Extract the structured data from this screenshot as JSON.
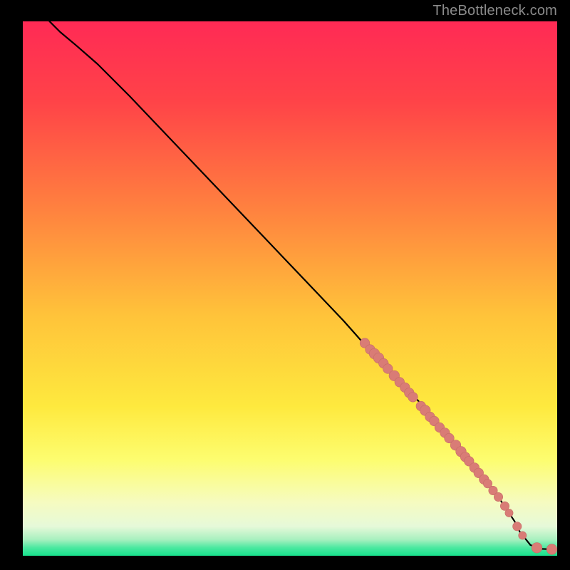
{
  "attribution": "TheBottleneck.com",
  "colors": {
    "frame_bg": "#000000",
    "attribution_text": "#8b8b8b",
    "curve": "#000000",
    "point_fill": "#d97c76",
    "point_stroke": "#c56c66",
    "gradient_stops": [
      {
        "offset": 0,
        "color": "#ff2a55"
      },
      {
        "offset": 0.15,
        "color": "#ff4348"
      },
      {
        "offset": 0.35,
        "color": "#ff813f"
      },
      {
        "offset": 0.55,
        "color": "#ffc33a"
      },
      {
        "offset": 0.72,
        "color": "#fee93e"
      },
      {
        "offset": 0.82,
        "color": "#fdfd6f"
      },
      {
        "offset": 0.9,
        "color": "#f6fbc0"
      },
      {
        "offset": 0.945,
        "color": "#e6f9d9"
      },
      {
        "offset": 0.97,
        "color": "#a7f0bf"
      },
      {
        "offset": 0.985,
        "color": "#4be8a0"
      },
      {
        "offset": 1.0,
        "color": "#18e28d"
      }
    ]
  },
  "chart_data": {
    "type": "line",
    "title": "",
    "xlabel": "",
    "ylabel": "",
    "xlim": [
      0,
      100
    ],
    "ylim": [
      0,
      100
    ],
    "series": [
      {
        "name": "curve",
        "x": [
          5,
          7,
          10,
          14,
          20,
          30,
          40,
          50,
          60,
          64,
          66,
          68,
          70,
          72,
          74,
          76,
          78,
          80,
          82,
          83,
          84,
          86,
          88,
          90,
          92,
          93,
          95,
          97,
          99
        ],
        "y": [
          100,
          98,
          95.5,
          92,
          86,
          75.5,
          65,
          54.5,
          44,
          39.5,
          37.5,
          35.5,
          33,
          31,
          29,
          26.5,
          24.5,
          22,
          20,
          18.5,
          17.5,
          15,
          12.5,
          9.5,
          6.5,
          4.5,
          2,
          1.3,
          1.2
        ]
      }
    ],
    "points": [
      {
        "x": 64.0,
        "y": 39.8,
        "r": 1.2
      },
      {
        "x": 65.0,
        "y": 38.6,
        "r": 1.2
      },
      {
        "x": 65.8,
        "y": 37.8,
        "r": 1.3
      },
      {
        "x": 66.6,
        "y": 37.0,
        "r": 1.3
      },
      {
        "x": 67.5,
        "y": 36.0,
        "r": 1.2
      },
      {
        "x": 68.3,
        "y": 35.0,
        "r": 1.2
      },
      {
        "x": 69.5,
        "y": 33.7,
        "r": 1.3
      },
      {
        "x": 70.5,
        "y": 32.5,
        "r": 1.2
      },
      {
        "x": 71.5,
        "y": 31.5,
        "r": 1.2
      },
      {
        "x": 72.3,
        "y": 30.5,
        "r": 1.2
      },
      {
        "x": 73.0,
        "y": 29.7,
        "r": 1.2
      },
      {
        "x": 74.5,
        "y": 28.0,
        "r": 1.2
      },
      {
        "x": 75.3,
        "y": 27.2,
        "r": 1.3
      },
      {
        "x": 76.2,
        "y": 26.0,
        "r": 1.2
      },
      {
        "x": 77.0,
        "y": 25.2,
        "r": 1.2
      },
      {
        "x": 78.0,
        "y": 24.0,
        "r": 1.2
      },
      {
        "x": 79.0,
        "y": 23.0,
        "r": 1.2
      },
      {
        "x": 79.8,
        "y": 22.0,
        "r": 1.2
      },
      {
        "x": 81.0,
        "y": 20.7,
        "r": 1.3
      },
      {
        "x": 82.0,
        "y": 19.5,
        "r": 1.3
      },
      {
        "x": 82.8,
        "y": 18.5,
        "r": 1.2
      },
      {
        "x": 83.5,
        "y": 17.7,
        "r": 1.2
      },
      {
        "x": 84.5,
        "y": 16.5,
        "r": 1.2
      },
      {
        "x": 85.3,
        "y": 15.5,
        "r": 1.2
      },
      {
        "x": 86.3,
        "y": 14.3,
        "r": 1.2
      },
      {
        "x": 87.0,
        "y": 13.5,
        "r": 1.1
      },
      {
        "x": 88.0,
        "y": 12.2,
        "r": 1.1
      },
      {
        "x": 89.0,
        "y": 11.0,
        "r": 1.1
      },
      {
        "x": 90.2,
        "y": 9.3,
        "r": 1.1
      },
      {
        "x": 91.0,
        "y": 8.0,
        "r": 1.0
      },
      {
        "x": 92.5,
        "y": 5.5,
        "r": 1.1
      },
      {
        "x": 93.5,
        "y": 3.8,
        "r": 1.0
      },
      {
        "x": 96.2,
        "y": 1.5,
        "r": 1.3
      },
      {
        "x": 99.0,
        "y": 1.2,
        "r": 1.3
      }
    ]
  }
}
